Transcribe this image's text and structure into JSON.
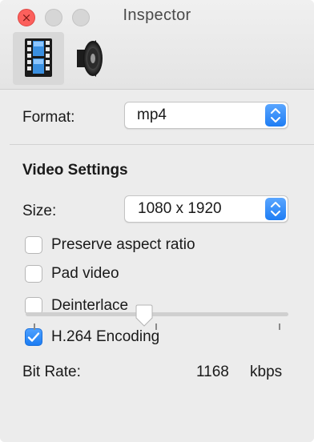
{
  "window": {
    "title": "Inspector",
    "close_glyph": "×"
  },
  "toolbar": {
    "tabs": [
      {
        "id": "video",
        "icon": "film-icon",
        "selected": true
      },
      {
        "id": "audio",
        "icon": "speaker-icon",
        "selected": false
      }
    ]
  },
  "format": {
    "label": "Format:",
    "value": "mp4"
  },
  "video_settings": {
    "heading": "Video Settings",
    "size_label": "Size:",
    "size_value": "1080 x 1920",
    "checkboxes": [
      {
        "label": "Preserve aspect ratio",
        "checked": false
      },
      {
        "label": "Pad video",
        "checked": false
      },
      {
        "label": "Deinterlace",
        "checked": false
      },
      {
        "label": "H.264 Encoding",
        "checked": true
      }
    ],
    "bitrate_label": "Bit Rate:",
    "bitrate_value": "1168",
    "bitrate_unit": "kbps",
    "bitrate_slider_fraction": 0.45
  },
  "colors": {
    "accent": "#1e7df4",
    "close": "#fc605c"
  }
}
